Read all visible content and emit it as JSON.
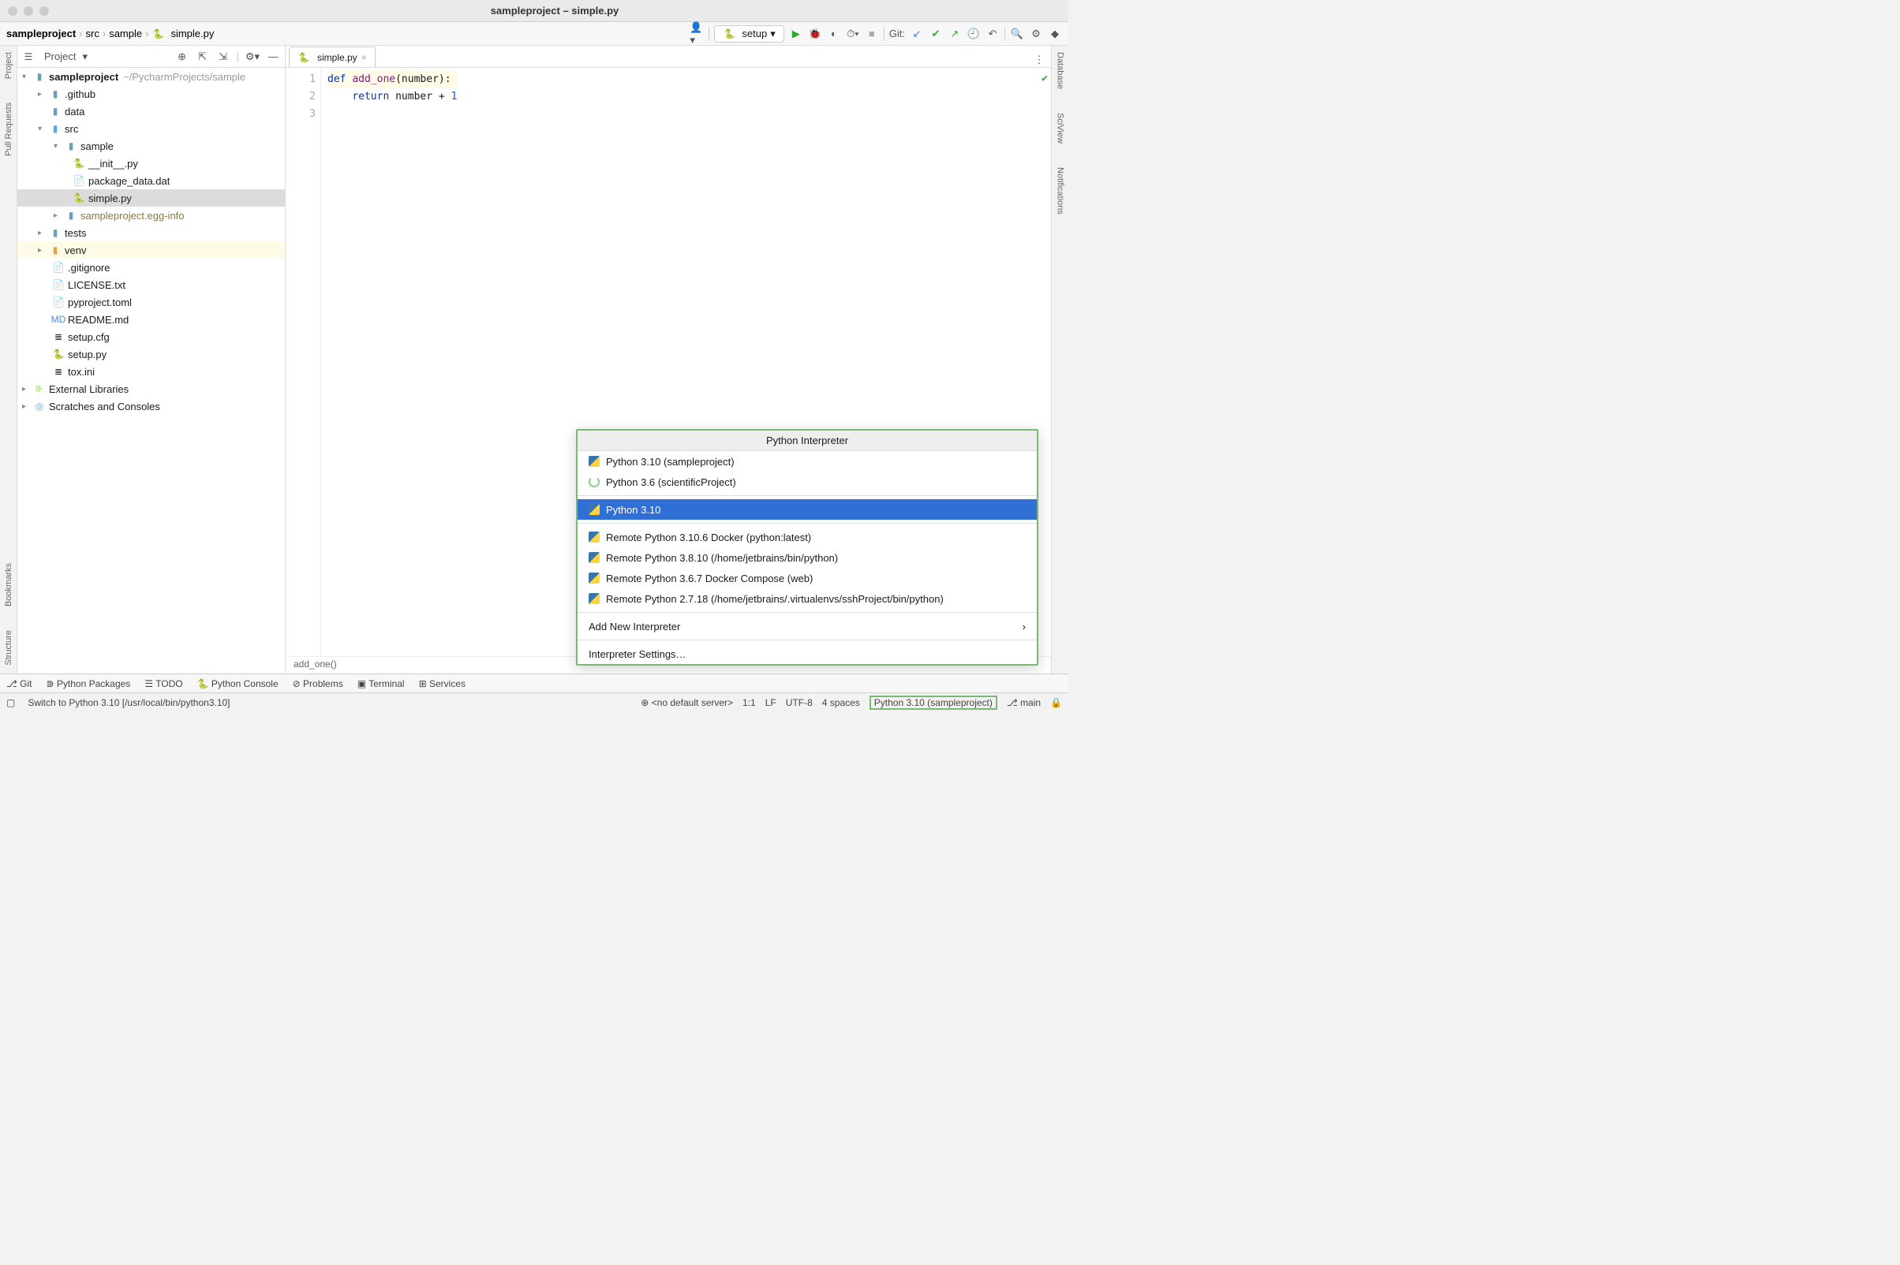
{
  "window": {
    "title": "sampleproject – simple.py"
  },
  "breadcrumbs": [
    "sampleproject",
    "src",
    "sample",
    "simple.py"
  ],
  "toolbar": {
    "config": "setup",
    "git_label": "Git:"
  },
  "left_rail": [
    "Project",
    "Pull Requests",
    "Bookmarks",
    "Structure"
  ],
  "right_rail": [
    "Database",
    "SciView",
    "Notifications"
  ],
  "project_panel": {
    "title": "Project",
    "tree": {
      "root": "sampleproject",
      "root_hint": "~/PycharmProjects/sample",
      "items": {
        "github": ".github",
        "data": "data",
        "src": "src",
        "sample": "sample",
        "init": "__init__.py",
        "pkgdata": "package_data.dat",
        "simple": "simple.py",
        "egginfo": "sampleproject.egg-info",
        "tests": "tests",
        "venv": "venv",
        "gitignore": ".gitignore",
        "license": "LICENSE.txt",
        "pyproject": "pyproject.toml",
        "readme": "README.md",
        "setupcfg": "setup.cfg",
        "setuppy": "setup.py",
        "tox": "tox.ini",
        "extlib": "External Libraries",
        "scratches": "Scratches and Consoles"
      }
    }
  },
  "tabs": [
    {
      "name": "simple.py"
    }
  ],
  "code": {
    "lines": [
      "1",
      "2",
      "3"
    ],
    "l1_kw": "def ",
    "l1_fn": "add_one",
    "l1_rest": "(number):",
    "l2_kw": "return ",
    "l2_mid": "number + ",
    "l2_num": "1"
  },
  "editor_footer": "add_one()",
  "popup": {
    "title": "Python Interpreter",
    "items": [
      {
        "label": "Python 3.10 (sampleproject)",
        "icon": "py"
      },
      {
        "label": "Python 3.6 (scientificProject)",
        "icon": "sci"
      }
    ],
    "selected": {
      "label": "Python 3.10",
      "icon": "py"
    },
    "remotes": [
      {
        "label": "Remote Python 3.10.6 Docker (python:latest)"
      },
      {
        "label": "Remote Python 3.8.10 (/home/jetbrains/bin/python)"
      },
      {
        "label": "Remote Python 3.6.7 Docker Compose (web)"
      },
      {
        "label": "Remote Python 2.7.18 (/home/jetbrains/.virtualenvs/sshProject/bin/python)"
      }
    ],
    "add_new": "Add New Interpreter",
    "settings": "Interpreter Settings…"
  },
  "tool_strip": [
    "Git",
    "Python Packages",
    "TODO",
    "Python Console",
    "Problems",
    "Terminal",
    "Services"
  ],
  "statusbar": {
    "left": "Switch to Python 3.10 [/usr/local/bin/python3.10]",
    "noserver": "<no default server>",
    "pos": "1:1",
    "le": "LF",
    "enc": "UTF-8",
    "indent": "4 spaces",
    "interp": "Python 3.10 (sampleproject)",
    "branch": "main"
  }
}
